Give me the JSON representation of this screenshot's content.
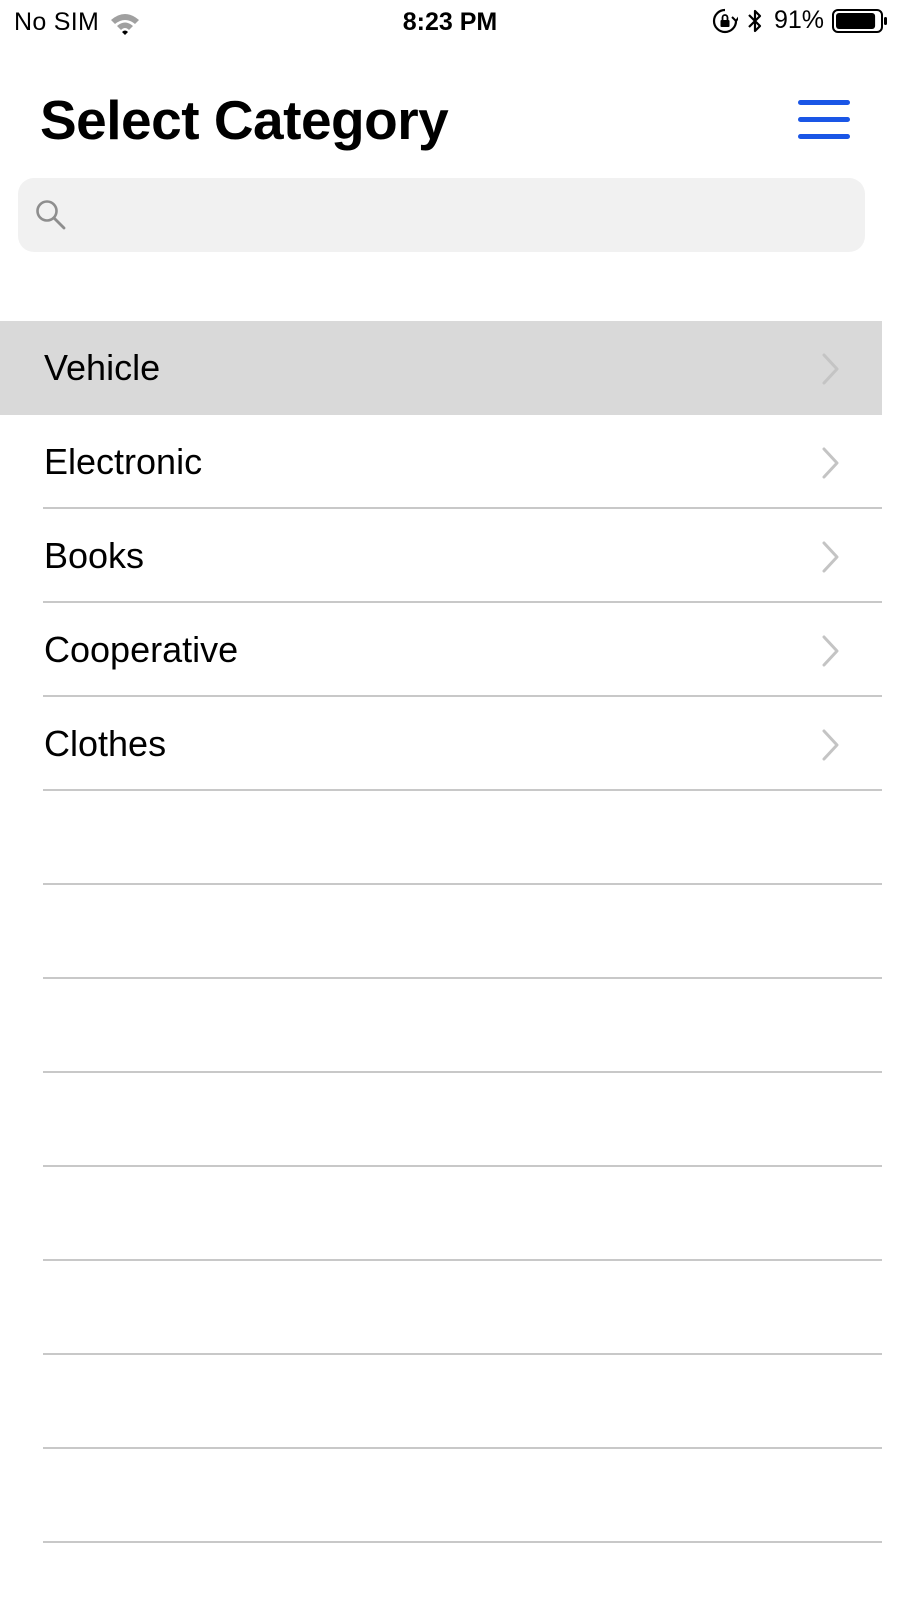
{
  "status_bar": {
    "carrier": "No SIM",
    "time": "8:23 PM",
    "battery_percent": "91%",
    "battery_level": 0.91
  },
  "header": {
    "title": "Select Category",
    "menu_icon": "hamburger-menu-icon",
    "accent_color": "#1a56e6"
  },
  "search": {
    "placeholder": "",
    "value": "",
    "icon": "search-icon"
  },
  "categories": [
    {
      "label": "Vehicle",
      "selected": true
    },
    {
      "label": "Electronic",
      "selected": false
    },
    {
      "label": "Books",
      "selected": false
    },
    {
      "label": "Cooperative",
      "selected": false
    },
    {
      "label": "Clothes",
      "selected": false
    }
  ],
  "colors": {
    "selected_row": "#d9d9d9",
    "separator": "#c8c8c8",
    "search_bg": "#f1f1f1"
  }
}
